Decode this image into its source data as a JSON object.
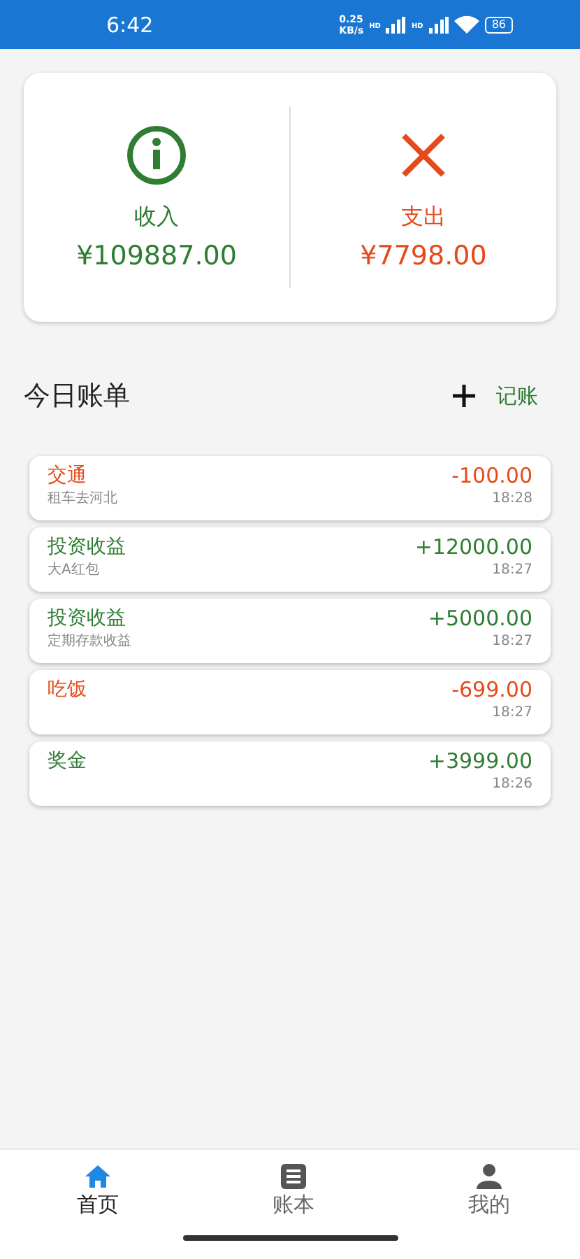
{
  "status_bar": {
    "time": "6:42",
    "speed_value": "0.25",
    "speed_unit": "KB/s",
    "network_labels": [
      "HD",
      "HD"
    ],
    "battery": "86"
  },
  "summary": [
    {
      "kind": "income",
      "label": "收入",
      "amount": "¥109887.00"
    },
    {
      "kind": "expense",
      "label": "支出",
      "amount": "¥7798.00"
    }
  ],
  "section": {
    "title": "今日账单",
    "add_button": "记账"
  },
  "bills": [
    {
      "kind": "expense",
      "category": "交通",
      "note": "租车去河北",
      "amount": "-100.00",
      "time": "18:28"
    },
    {
      "kind": "income",
      "category": "投资收益",
      "note": "大A红包",
      "amount": "+12000.00",
      "time": "18:27"
    },
    {
      "kind": "income",
      "category": "投资收益",
      "note": "定期存款收益",
      "amount": "+5000.00",
      "time": "18:27"
    },
    {
      "kind": "expense",
      "category": "吃饭",
      "amount": "-699.00",
      "time": "18:27"
    },
    {
      "kind": "income",
      "category": "奖金",
      "amount": "+3999.00",
      "time": "18:26"
    }
  ],
  "tab_bar": [
    {
      "kind": "home",
      "label": "首页",
      "selected": true
    },
    {
      "kind": "book",
      "label": "账本",
      "selected": false
    },
    {
      "kind": "person",
      "label": "我的",
      "selected": false
    }
  ]
}
